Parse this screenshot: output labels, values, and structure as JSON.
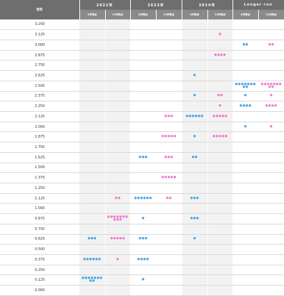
{
  "colors": {
    "six_month": "#4ba7e9",
    "twelve_month": "#f07cd2",
    "header_bg": "#6e6e6e"
  },
  "chart_data": {
    "type": "dot_plot",
    "title": "",
    "row_header": "金利",
    "groups": [
      {
        "label": "2022年",
        "columns": [
          "6月時点",
          "12月時点"
        ]
      },
      {
        "label": "2023年",
        "columns": [
          "6月時点",
          "12月時点"
        ]
      },
      {
        "label": "2024年",
        "columns": [
          "6月時点",
          "12月時点"
        ]
      },
      {
        "label": "Longer run",
        "columns": [
          "6月時点",
          "12月時点"
        ]
      }
    ],
    "rates": [
      "3.250",
      "3.125",
      "3.000",
      "2.875",
      "2.750",
      "2.625",
      "2.500",
      "2.375",
      "2.250",
      "2.125",
      "2.000",
      "1.875",
      "1.750",
      "1.625",
      "1.500",
      "1.375",
      "1.250",
      "1.125",
      "1.000",
      "0.875",
      "0.750",
      "0.625",
      "0.500",
      "0.375",
      "0.250",
      "0.125",
      "0.000"
    ],
    "series": [
      {
        "column": 0,
        "points": [
          [
            0.625,
            3
          ],
          [
            0.375,
            6
          ],
          [
            0.125,
            9
          ]
        ]
      },
      {
        "column": 1,
        "points": [
          [
            1.125,
            2
          ],
          [
            0.875,
            10
          ],
          [
            0.625,
            5
          ],
          [
            0.375,
            1
          ]
        ]
      },
      {
        "column": 2,
        "points": [
          [
            1.625,
            3
          ],
          [
            1.125,
            6
          ],
          [
            0.875,
            1
          ],
          [
            0.625,
            3
          ],
          [
            0.375,
            4
          ],
          [
            0.125,
            1
          ]
        ]
      },
      {
        "column": 3,
        "points": [
          [
            2.125,
            3
          ],
          [
            1.875,
            5
          ],
          [
            1.625,
            3
          ],
          [
            1.375,
            5
          ],
          [
            1.125,
            2
          ]
        ]
      },
      {
        "column": 4,
        "points": [
          [
            2.625,
            1
          ],
          [
            2.375,
            1
          ],
          [
            2.125,
            6
          ],
          [
            1.875,
            1
          ],
          [
            1.625,
            2
          ],
          [
            1.125,
            3
          ],
          [
            0.875,
            3
          ],
          [
            0.625,
            1
          ]
        ]
      },
      {
        "column": 5,
        "points": [
          [
            3.125,
            1
          ],
          [
            2.875,
            4
          ],
          [
            2.375,
            2
          ],
          [
            2.25,
            1
          ],
          [
            2.125,
            5
          ],
          [
            1.875,
            5
          ]
        ]
      },
      {
        "column": 6,
        "points": [
          [
            3.0,
            2
          ],
          [
            2.5,
            9
          ],
          [
            2.375,
            1
          ],
          [
            2.25,
            4
          ],
          [
            2.0,
            1
          ]
        ]
      },
      {
        "column": 7,
        "points": [
          [
            3.0,
            2
          ],
          [
            2.5,
            9
          ],
          [
            2.375,
            1
          ],
          [
            2.25,
            4
          ],
          [
            2.0,
            1
          ]
        ]
      }
    ]
  }
}
